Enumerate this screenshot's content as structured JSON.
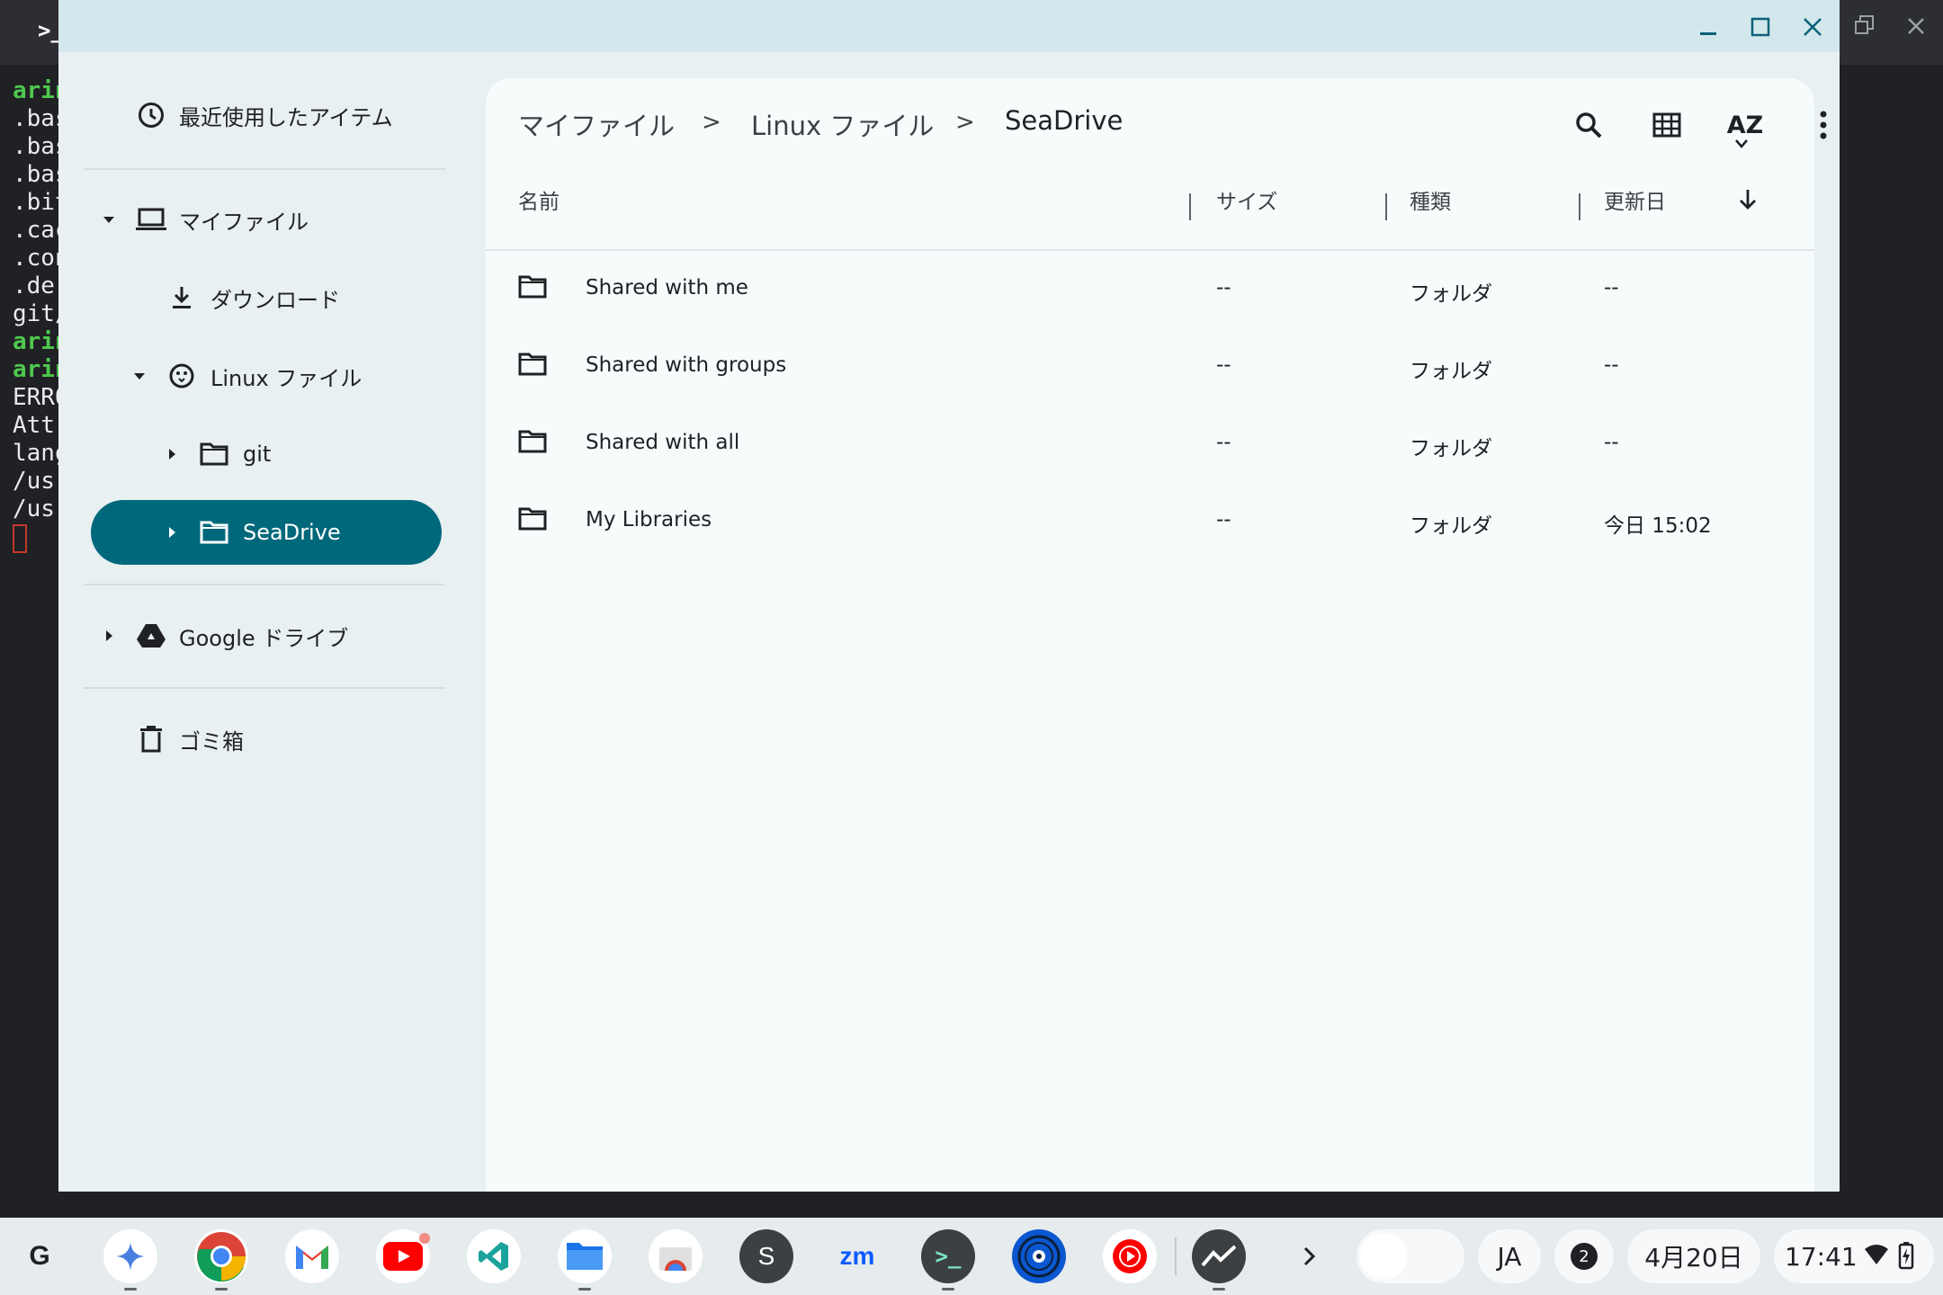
{
  "terminal": {
    "prompt_icon": ">_",
    "lines": [
      {
        "text": "arin",
        "green": true
      },
      {
        "text": ".bas",
        "green": false
      },
      {
        "text": ".bas",
        "green": false
      },
      {
        "text": ".bas",
        "green": false
      },
      {
        "text": ".bit",
        "green": false
      },
      {
        "text": ".cac",
        "green": false
      },
      {
        "text": ".con",
        "green": false
      },
      {
        "text": ".der",
        "green": false
      },
      {
        "text": "git/",
        "green": false
      },
      {
        "text": "arin",
        "green": true
      },
      {
        "text": "arin",
        "green": true
      },
      {
        "text": "ERRO",
        "green": false
      },
      {
        "text": "Attr",
        "green": false
      },
      {
        "text": "lang",
        "green": false
      },
      {
        "text": "/usr",
        "green": false
      },
      {
        "text": "/usr",
        "green": false
      }
    ]
  },
  "sidebar": {
    "recent": "最近使用したアイテム",
    "my_files": "マイファイル",
    "downloads": "ダウンロード",
    "linux_files": "Linux ファイル",
    "git": "git",
    "seadrive": "SeaDrive",
    "google_drive": "Google ドライブ",
    "trash": "ゴミ箱"
  },
  "breadcrumb": {
    "items": [
      "マイファイル",
      "Linux ファイル",
      "SeaDrive"
    ],
    "separator": ">"
  },
  "toolbar": {
    "sort_label": "AZ"
  },
  "columns": {
    "name": "名前",
    "size": "サイズ",
    "type": "種類",
    "modified": "更新日"
  },
  "files": [
    {
      "name": "Shared with me",
      "size": "--",
      "type": "フォルダ",
      "modified": "--"
    },
    {
      "name": "Shared with groups",
      "size": "--",
      "type": "フォルダ",
      "modified": "--"
    },
    {
      "name": "Shared with all",
      "size": "--",
      "type": "フォルダ",
      "modified": "--"
    },
    {
      "name": "My Libraries",
      "size": "--",
      "type": "フォルダ",
      "modified": "今日 15:02"
    }
  ],
  "shelf": {
    "launcher": "G",
    "s_app": "S",
    "zoom": "zm",
    "terminal_app": ">_",
    "ime": "JA",
    "notifications": "2",
    "date": "4月20日",
    "time": "17:41"
  },
  "colors": {
    "accent": "#00687b",
    "window_bg": "#e8f0f2",
    "titlebar": "#d3e8ec",
    "main_bg": "#f6fbfc"
  }
}
